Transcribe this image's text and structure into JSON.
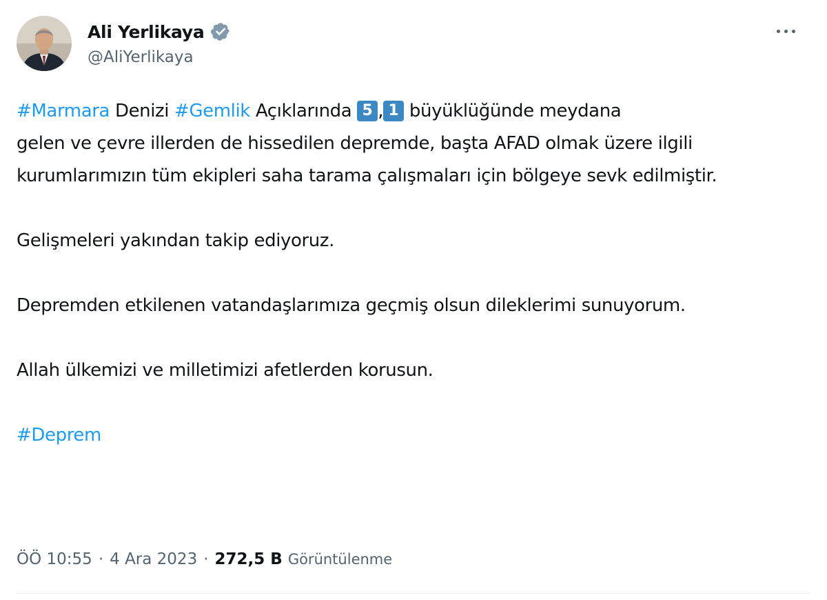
{
  "author": {
    "name": "Ali Yerlikaya",
    "handle": "@AliYerlikaya",
    "verified_icon": "verified-badge-icon",
    "verified_color": "#829aab"
  },
  "tweet": {
    "line1": {
      "tag1": "#Marmara",
      "text1": " Denizi ",
      "tag2": "#Gemlik",
      "text2": " Açıklarında  ",
      "key1": "5",
      "comma": ",",
      "key2": "1",
      "text3": "  büyüklüğünde meydana"
    },
    "para1_rest": "gelen ve çevre illerden de hissedilen depremde, başta AFAD olmak üzere ilgili kurumlarımızın tüm ekipleri saha tarama çalışmaları için bölgeye sevk edilmiştir.",
    "para2": "Gelişmeleri yakından takip ediyoruz.",
    "para3": "Depremden etkilenen vatandaşlarımıza geçmiş olsun dileklerimi sunuyorum.",
    "para4": "Allah ülkemizi ve milletimizi afetlerden korusun.",
    "hashtag_footer": "#Deprem"
  },
  "meta": {
    "time": "ÖÖ 10:55",
    "separator": "·",
    "date": "4 Ara 2023",
    "views_count": "272,5 B",
    "views_label": "Görüntülenme"
  },
  "colors": {
    "link": "#1d9bf0",
    "text": "#0f1419",
    "secondary": "#536471",
    "keycap": "#3b88c3"
  },
  "icons": {
    "more": "more-options-icon"
  }
}
